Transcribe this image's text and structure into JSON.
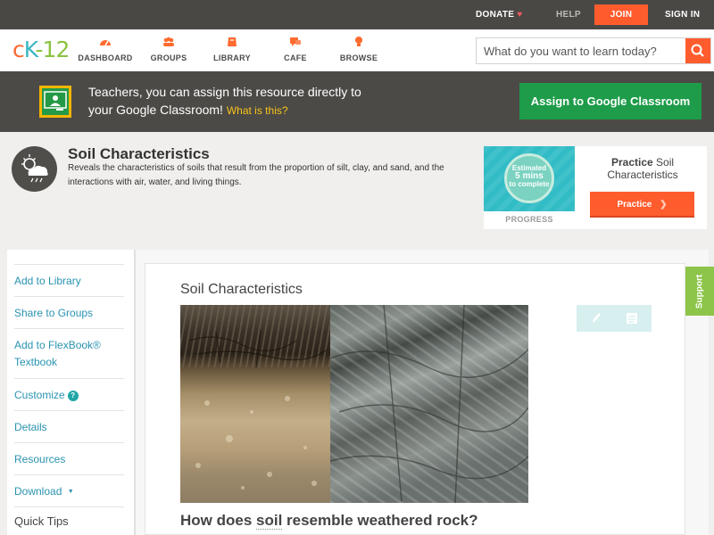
{
  "topbar": {
    "donate": "DONATE",
    "help": "HELP",
    "join": "JOIN",
    "signin": "SIGN IN"
  },
  "logo": {
    "part1": "c",
    "part2": "K",
    "part3": "-12"
  },
  "nav": {
    "dashboard": "DASHBOARD",
    "groups": "GROUPS",
    "library": "LIBRARY",
    "cafe": "CAFE",
    "browse": "BROWSE"
  },
  "search": {
    "placeholder": "What do you want to learn today?"
  },
  "classroom": {
    "message_line1": "Teachers, you can assign this resource directly to",
    "message_line2": "your Google Classroom!",
    "what_is_this": "What is this?",
    "assign_button": "Assign to Google Classroom"
  },
  "resource": {
    "title": "Soil Characteristics",
    "description": "Reveals the characteristics of soils that result from the proportion of silt, clay, and sand, and the interactions with air, water, and living things."
  },
  "practice_card": {
    "estimated": "Estimated",
    "mins": "5 mins",
    "to_complete": "to complete",
    "progress_label": "PROGRESS",
    "practice_bold": "Practice",
    "practice_topic": "Soil Characteristics",
    "practice_button": "Practice"
  },
  "sidebar": {
    "items": [
      "Add to Library",
      "Share to Groups",
      "Add to FlexBook®",
      "Textbook",
      "Customize",
      "Details",
      "Resources",
      "Download"
    ],
    "customize_badge": "?",
    "download_arrow": "▼",
    "quick_tips": "Quick Tips"
  },
  "main": {
    "title": "Soil Characteristics",
    "question_pre": "How does ",
    "question_term": "soil",
    "question_post": " resemble weathered rock?"
  },
  "support": "Support",
  "colors": {
    "accent_orange": "#ff5c2e",
    "classroom_green": "#1e9c4a",
    "link_blue": "#2a93b1",
    "support_green": "#8dc54a"
  }
}
